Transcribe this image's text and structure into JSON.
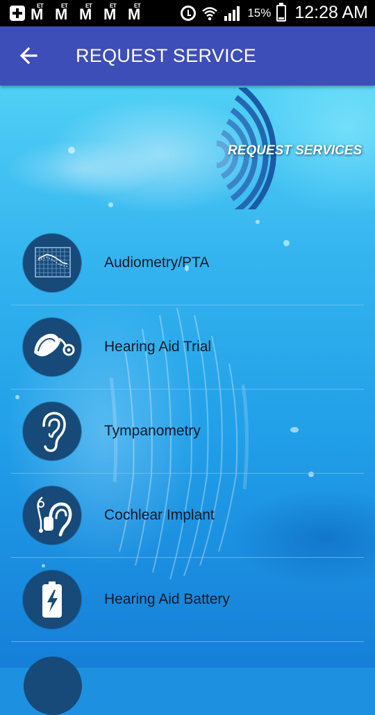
{
  "status_bar": {
    "notification_icons": [
      "plus-box-icon",
      "et-m-icon",
      "et-m-icon",
      "et-m-icon",
      "et-m-icon",
      "et-m-icon"
    ],
    "et_label": "ET",
    "m_label": "M",
    "battery_percent": "15%",
    "time": "12:28 AM"
  },
  "app_bar": {
    "title": "REQUEST SERVICE",
    "back_icon": "arrow-back-icon"
  },
  "header": {
    "banner_text": "REQUEST SERVICES"
  },
  "services": [
    {
      "label": "Audiometry/PTA",
      "icon": "audiogram-chart-icon"
    },
    {
      "label": "Hearing Aid Trial",
      "icon": "hearing-aid-icon"
    },
    {
      "label": "Tympanometry",
      "icon": "ear-icon"
    },
    {
      "label": "Cochlear Implant",
      "icon": "cochlear-implant-icon"
    },
    {
      "label": "Hearing Aid Battery",
      "icon": "battery-icon"
    }
  ],
  "colors": {
    "app_bar": "#3e4eb8",
    "icon_circle": "#174a78",
    "label_text": "#101a2a"
  }
}
